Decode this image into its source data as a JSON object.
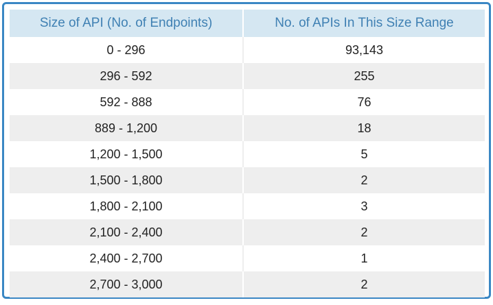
{
  "table": {
    "headers": [
      "Size of API (No. of Endpoints)",
      "No. of APIs In This Size Range"
    ],
    "rows": [
      [
        "0 - 296",
        "93,143"
      ],
      [
        "296 - 592",
        "255"
      ],
      [
        "592 - 888",
        "76"
      ],
      [
        "889 - 1,200",
        "18"
      ],
      [
        "1,200 - 1,500",
        "5"
      ],
      [
        "1,500 - 1,800",
        "2"
      ],
      [
        "1,800 - 2,100",
        "3"
      ],
      [
        "2,100 - 2,400",
        "2"
      ],
      [
        "2,400 - 2,700",
        "1"
      ],
      [
        "2,700 - 3,000",
        "2"
      ]
    ]
  },
  "colors": {
    "border": "#3a87c4",
    "header_bg": "#d5e7f2",
    "header_text": "#3f80b3",
    "stripe": "#eeeeee"
  }
}
